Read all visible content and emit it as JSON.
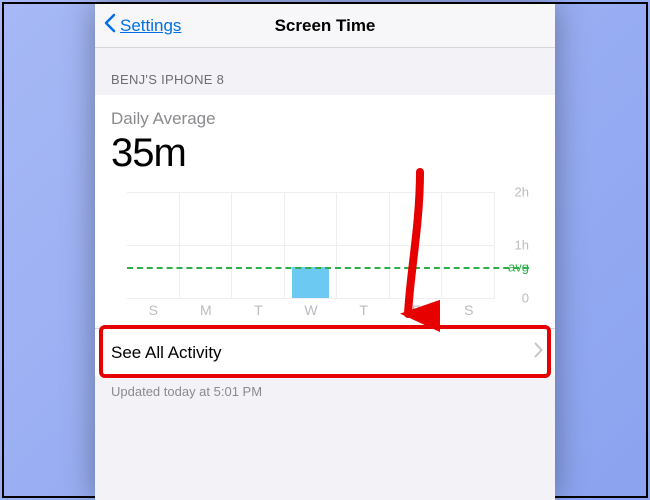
{
  "nav": {
    "back_label": "Settings",
    "title": "Screen Time"
  },
  "section_header": "BENJ'S IPHONE 8",
  "daily_average": {
    "label": "Daily Average",
    "value": "35m"
  },
  "chart_data": {
    "type": "bar",
    "categories": [
      "S",
      "M",
      "T",
      "W",
      "T",
      "F",
      "S"
    ],
    "values": [
      0,
      0,
      0,
      35,
      0,
      0,
      0
    ],
    "ylabel": "",
    "xlabel": "",
    "ylim": [
      0,
      120
    ],
    "y_ticks": [
      0,
      60,
      120
    ],
    "y_tick_labels": [
      "0",
      "1h",
      "2h"
    ],
    "avg_value": 35,
    "avg_label": "avg"
  },
  "see_all": {
    "label": "See All Activity"
  },
  "updated": "Updated today at 5:01 PM",
  "colors": {
    "accent_blue": "#006fe7",
    "bar": "#6bc9f2",
    "avg_green": "#2db04a",
    "annotation_red": "#e60000"
  }
}
